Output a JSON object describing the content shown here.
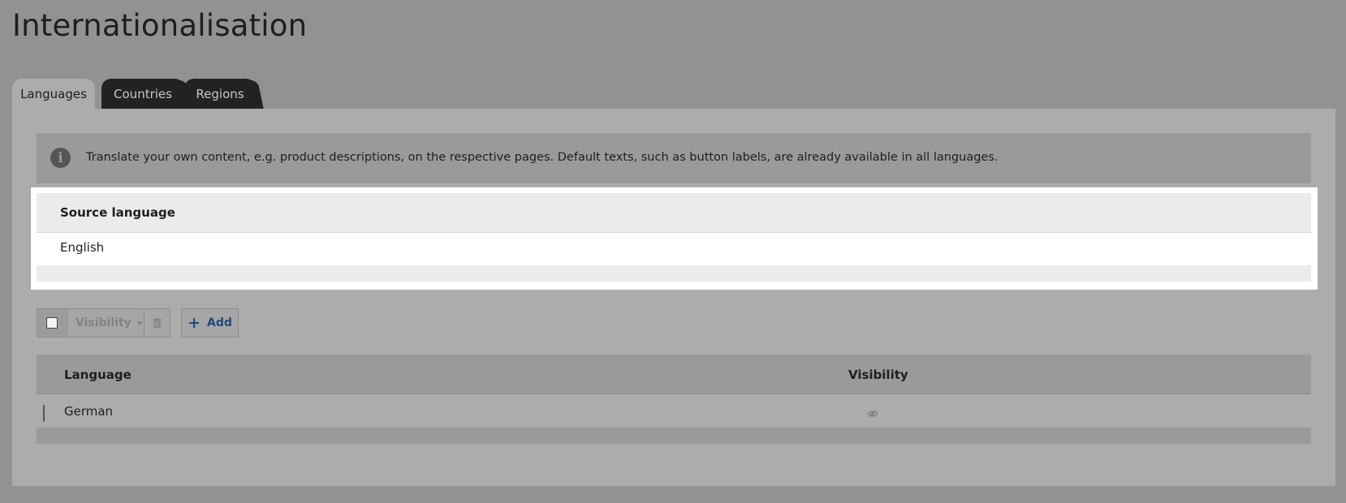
{
  "page": {
    "title": "Internationalisation"
  },
  "tabs": [
    {
      "label": "Languages",
      "active": true
    },
    {
      "label": "Countries",
      "active": false
    },
    {
      "label": "Regions",
      "active": false
    }
  ],
  "info": {
    "icon": "info-icon",
    "text": "Translate your own content, e.g. product descriptions, on the respective pages. Default texts, such as button labels, are already available in all languages."
  },
  "source_language": {
    "header": "Source language",
    "value": "English"
  },
  "toolbar": {
    "visibility_label": "Visibility",
    "add_label": "Add"
  },
  "languages_table": {
    "columns": [
      "Language",
      "Visibility"
    ],
    "rows": [
      {
        "language": "German",
        "visibility_icon": "eye-icon"
      }
    ]
  },
  "colors": {
    "backdrop": "#929292",
    "panel": "#acacac",
    "highlight": "#ffffff",
    "dark_tab": "#222222",
    "link": "#1f4a7a"
  }
}
